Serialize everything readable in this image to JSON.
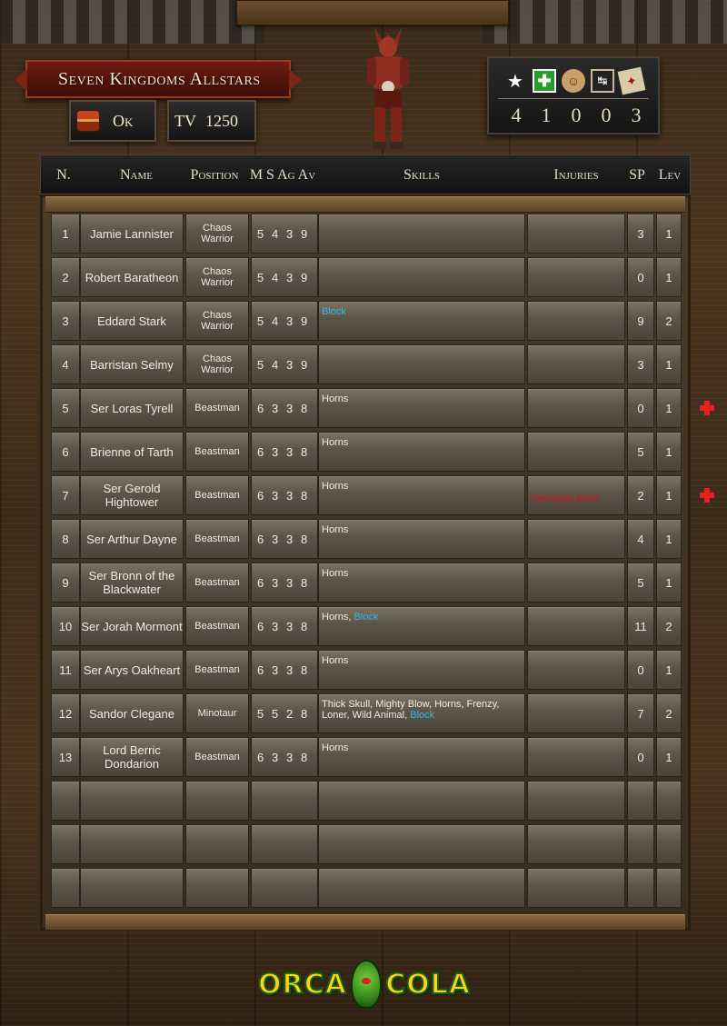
{
  "team": {
    "name": "Seven Kingdoms Allstars",
    "status": "Ok",
    "tv_label": "TV",
    "tv_value": "1250"
  },
  "team_stats": {
    "icons": [
      "star-icon",
      "medical-cross-icon",
      "cheerleader-icon",
      "coach-icon",
      "apothecary-icon"
    ],
    "values": [
      "4",
      "1",
      "0",
      "0",
      "3"
    ]
  },
  "roster_header": {
    "number": "N.",
    "name": "Name",
    "position": "Position",
    "stats": "M S Ag Av",
    "skills": "Skills",
    "injuries": "Injuries",
    "sp": "SP",
    "level": "Lev"
  },
  "players": [
    {
      "n": "1",
      "name": "Jamie Lannister",
      "position": "Chaos Warrior",
      "m": "5",
      "s": "4",
      "ag": "3",
      "av": "9",
      "skills": "",
      "learned": "",
      "injury": "",
      "sp": "3",
      "lev": "1"
    },
    {
      "n": "2",
      "name": "Robert Baratheon",
      "position": "Chaos Warrior",
      "m": "5",
      "s": "4",
      "ag": "3",
      "av": "9",
      "skills": "",
      "learned": "",
      "injury": "",
      "sp": "0",
      "lev": "1"
    },
    {
      "n": "3",
      "name": "Eddard Stark",
      "position": "Chaos Warrior",
      "m": "5",
      "s": "4",
      "ag": "3",
      "av": "9",
      "skills": "",
      "learned": "Block",
      "injury": "",
      "sp": "9",
      "lev": "2"
    },
    {
      "n": "4",
      "name": "Barristan Selmy",
      "position": "Chaos Warrior",
      "m": "5",
      "s": "4",
      "ag": "3",
      "av": "9",
      "skills": "",
      "learned": "",
      "injury": "",
      "sp": "3",
      "lev": "1"
    },
    {
      "n": "5",
      "name": "Ser Loras Tyrell",
      "position": "Beastman",
      "m": "6",
      "s": "3",
      "ag": "3",
      "av": "8",
      "skills": "Horns",
      "learned": "",
      "injury": "",
      "sp": "0",
      "lev": "1",
      "injured": true
    },
    {
      "n": "6",
      "name": "Brienne of Tarth",
      "position": "Beastman",
      "m": "6",
      "s": "3",
      "ag": "3",
      "av": "8",
      "skills": "Horns",
      "learned": "",
      "injury": "",
      "sp": "5",
      "lev": "1"
    },
    {
      "n": "7",
      "name": "Ser Gerold Hightower",
      "position": "Beastman",
      "m": "6",
      "s": "3",
      "ag": "3",
      "av": "8",
      "skills": "Horns",
      "learned": "",
      "injury": "Damaged Back",
      "sp": "2",
      "lev": "1",
      "injured": true
    },
    {
      "n": "8",
      "name": "Ser Arthur Dayne",
      "position": "Beastman",
      "m": "6",
      "s": "3",
      "ag": "3",
      "av": "8",
      "skills": "Horns",
      "learned": "",
      "injury": "",
      "sp": "4",
      "lev": "1"
    },
    {
      "n": "9",
      "name": "Ser Bronn of the Blackwater",
      "position": "Beastman",
      "m": "6",
      "s": "3",
      "ag": "3",
      "av": "8",
      "skills": "Horns",
      "learned": "",
      "injury": "",
      "sp": "5",
      "lev": "1"
    },
    {
      "n": "10",
      "name": "Ser Jorah Mormont",
      "position": "Beastman",
      "m": "6",
      "s": "3",
      "ag": "3",
      "av": "8",
      "skills": "Horns",
      "learned": "Block",
      "injury": "",
      "sp": "11",
      "lev": "2"
    },
    {
      "n": "11",
      "name": "Ser Arys Oakheart",
      "position": "Beastman",
      "m": "6",
      "s": "3",
      "ag": "3",
      "av": "8",
      "skills": "Horns",
      "learned": "",
      "injury": "",
      "sp": "0",
      "lev": "1"
    },
    {
      "n": "12",
      "name": "Sandor Clegane",
      "position": "Minotaur",
      "m": "5",
      "s": "5",
      "ag": "2",
      "av": "8",
      "skills": "Thick Skull, Mighty Blow, Horns, Frenzy, Loner, Wild Animal",
      "learned": "Block",
      "injury": "",
      "sp": "7",
      "lev": "2"
    },
    {
      "n": "13",
      "name": "Lord Berric Dondarion",
      "position": "Beastman",
      "m": "6",
      "s": "3",
      "ag": "3",
      "av": "8",
      "skills": "Horns",
      "learned": "",
      "injury": "",
      "sp": "0",
      "lev": "1"
    }
  ],
  "empty_rows": 3,
  "logo": {
    "left": "ORCA",
    "right": "COLA"
  }
}
